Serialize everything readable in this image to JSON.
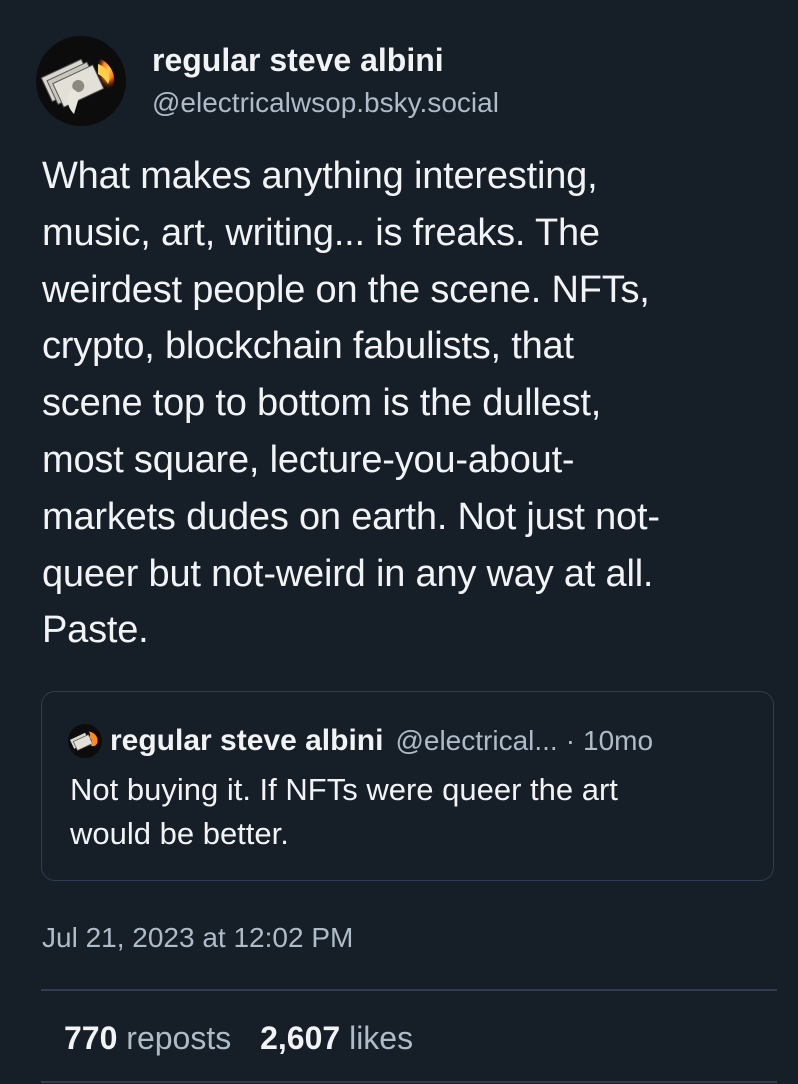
{
  "post": {
    "author": {
      "display_name": "regular steve albini",
      "handle": "@electricalwsop.bsky.social",
      "avatar_icon": "burning-money-avatar"
    },
    "text_lines": [
      "What makes anything interesting,",
      "music, art, writing... is freaks. The",
      "weirdest people on the scene. NFTs,",
      "crypto, blockchain fabulists, that",
      "scene top to bottom is the dullest,",
      "most square, lecture-you-about-",
      "markets dudes on earth. Not just not-",
      "queer but not-weird in any way at all.",
      "Paste."
    ],
    "quote": {
      "author_name": "regular steve albini",
      "handle": "@electrical...",
      "separator": "·",
      "time": "10mo",
      "text_lines": [
        "Not buying it. If NFTs were queer the art",
        "would be better."
      ]
    },
    "timestamp": "Jul 21, 2023 at 12:02 PM",
    "stats": {
      "reposts_count": "770",
      "reposts_label": "reposts",
      "likes_count": "2,607",
      "likes_label": "likes"
    }
  },
  "colors": {
    "background": "#161e27",
    "text_primary": "#f1f3f5",
    "text_secondary": "#aebbc9",
    "border": "#2e3d4f"
  }
}
